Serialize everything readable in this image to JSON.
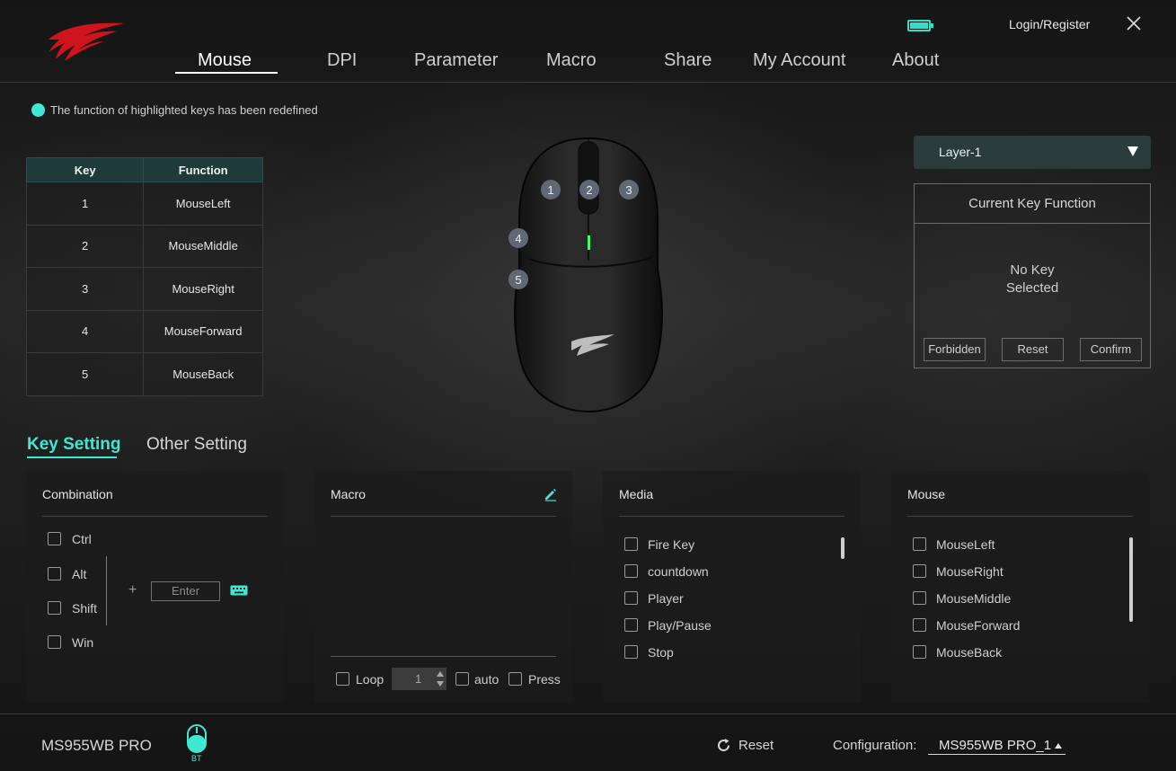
{
  "header": {
    "login_label": "Login/Register",
    "battery_color": "#31e0c8",
    "accent_color": "#3ee8d2"
  },
  "nav": {
    "tabs": [
      {
        "label": "Mouse",
        "active": true
      },
      {
        "label": "DPI"
      },
      {
        "label": "Parameter"
      },
      {
        "label": "Macro"
      },
      {
        "label": "Share"
      },
      {
        "label": "My Account"
      },
      {
        "label": "About"
      }
    ]
  },
  "hint": "The function of highlighted keys has been redefined",
  "key_table": {
    "headers": [
      "Key",
      "Function"
    ],
    "rows": [
      {
        "key": "1",
        "function": "MouseLeft"
      },
      {
        "key": "2",
        "function": "MouseMiddle"
      },
      {
        "key": "3",
        "function": "MouseRight"
      },
      {
        "key": "4",
        "function": "MouseForward"
      },
      {
        "key": "5",
        "function": "MouseBack"
      }
    ]
  },
  "mouse_badges": [
    "1",
    "2",
    "3",
    "4",
    "5"
  ],
  "layer": {
    "selected": "Layer-1"
  },
  "current_key": {
    "title": "Current Key Function",
    "line1": "No Key",
    "line2": "Selected",
    "buttons": [
      "Forbidden",
      "Reset",
      "Confirm"
    ]
  },
  "settings_tabs": {
    "key": "Key Setting",
    "other": "Other Setting"
  },
  "combination": {
    "title": "Combination",
    "options": [
      "Ctrl",
      "Alt",
      "Shift",
      "Win"
    ],
    "plus": "+",
    "placeholder": "Enter"
  },
  "macro": {
    "title": "Macro",
    "loop": "Loop",
    "loop_value": "1",
    "auto": "auto",
    "press": "Press"
  },
  "media": {
    "title": "Media",
    "items": [
      "Fire Key",
      "countdown",
      "Player",
      "Play/Pause",
      "Stop"
    ]
  },
  "mouse_panel": {
    "title": "Mouse",
    "items": [
      "MouseLeft",
      "MouseRight",
      "MouseMiddle",
      "MouseForward",
      "MouseBack"
    ]
  },
  "footer": {
    "device": "MS955WB PRO",
    "bt": "BT",
    "reset": "Reset",
    "config_label": "Configuration:",
    "config_value": "MS955WB PRO_1"
  }
}
